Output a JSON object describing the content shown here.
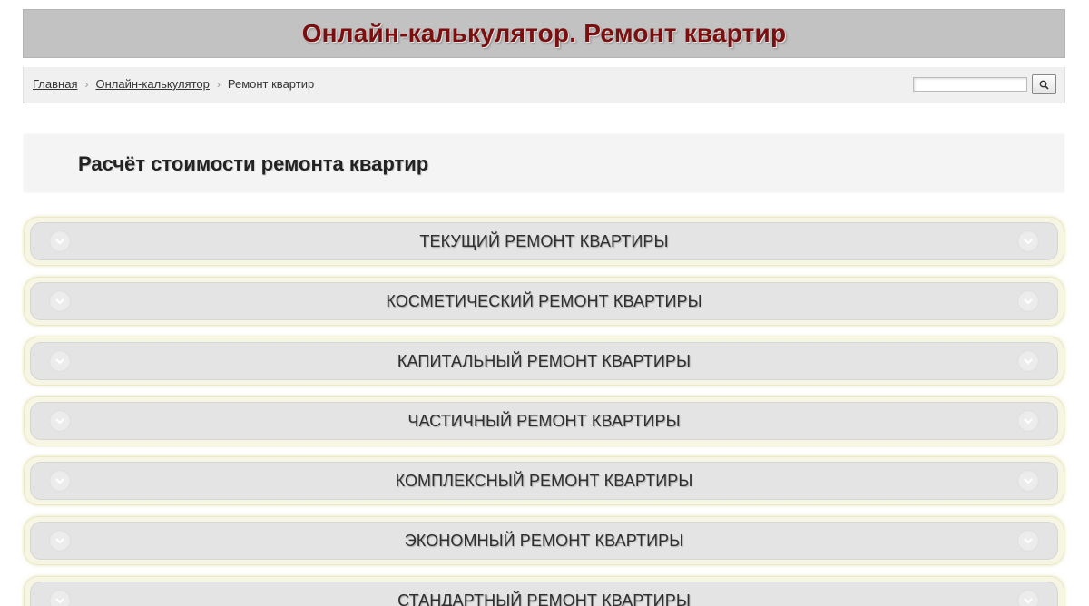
{
  "header": {
    "title": "Онлайн-калькулятор. Ремонт квартир"
  },
  "breadcrumb": {
    "home": "Главная",
    "calculator": "Онлайн-калькулятор",
    "current": "Ремонт квартир",
    "separator": "›"
  },
  "search": {
    "value": "",
    "button_icon": "search-icon"
  },
  "section": {
    "title": "Расчёт стоимости ремонта квартир"
  },
  "accordion": [
    {
      "label": "ТЕКУЩИЙ РЕМОНТ КВАРТИРЫ"
    },
    {
      "label": "КОСМЕТИЧЕСКИЙ РЕМОНТ КВАРТИРЫ"
    },
    {
      "label": "КАПИТАЛЬНЫЙ РЕМОНТ КВАРТИРЫ"
    },
    {
      "label": "ЧАСТИЧНЫЙ РЕМОНТ КВАРТИРЫ"
    },
    {
      "label": "КОМПЛЕКСНЫЙ РЕМОНТ КВАРТИРЫ"
    },
    {
      "label": "ЭКОНОМНЫЙ РЕМОНТ КВАРТИРЫ"
    },
    {
      "label": "СТАНДАРТНЫЙ РЕМОНТ КВАРТИРЫ"
    }
  ],
  "colors": {
    "title": "#7b0e0e",
    "header_bg": "#c2c2c2",
    "accordion_bg": "#e4e4e4",
    "accordion_outline": "#f7f6e4"
  }
}
